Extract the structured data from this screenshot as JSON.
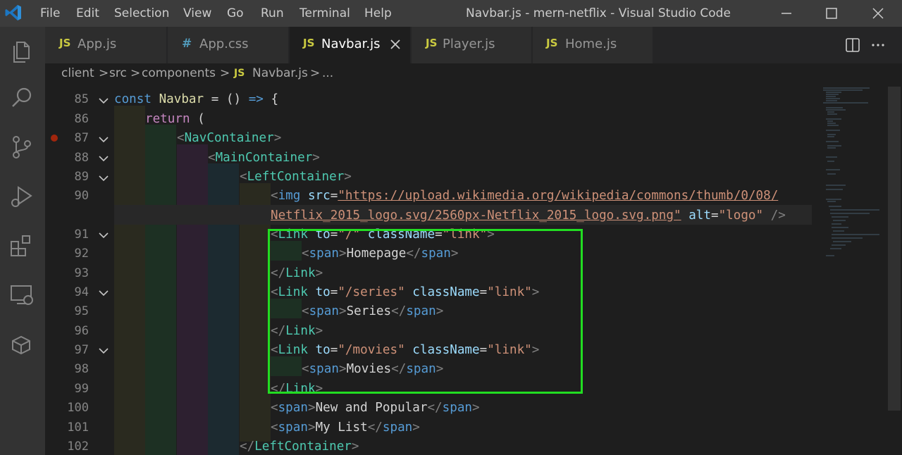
{
  "titlebar": {
    "menu": [
      "File",
      "Edit",
      "Selection",
      "View",
      "Go",
      "Run",
      "Terminal",
      "Help"
    ],
    "title": "Navbar.js - mern-netflix - Visual Studio Code"
  },
  "tabs": [
    {
      "type": "JS",
      "label": "App.js",
      "active": false
    },
    {
      "type": "#",
      "label": "App.css",
      "active": false
    },
    {
      "type": "JS",
      "label": "Navbar.js",
      "active": true
    },
    {
      "type": "JS",
      "label": "Player.js",
      "active": false
    },
    {
      "type": "JS",
      "label": "Home.js",
      "active": false
    }
  ],
  "breadcrumbs": {
    "items": [
      "client",
      "src",
      "components"
    ],
    "file_type": "JS",
    "file": "Navbar.js",
    "more": "..."
  },
  "editor": {
    "line_numbers": [
      "85",
      "86",
      "87",
      "88",
      "89",
      "90",
      "",
      "91",
      "92",
      "93",
      "94",
      "95",
      "96",
      "97",
      "98",
      "99",
      "100",
      "101",
      "102"
    ],
    "url_part1": "\"https://upload.wikimedia.org/wikipedia/commons/thumb/0/08/",
    "url_part2": "Netflix_2015_logo.svg/2560px-Netflix_2015_logo.svg.png\"",
    "alt_value": "\"logo\"",
    "link_texts": [
      "Homepage",
      "Series",
      "Movies"
    ],
    "link_paths": [
      "\"/\"",
      "\"/series\"",
      "\"/movies\""
    ],
    "class_value": "\"link\"",
    "span_texts": [
      "New and Popular",
      "My List"
    ]
  },
  "colors": {
    "highlight": "#22dd22",
    "breakpoint": "#a1260d"
  }
}
